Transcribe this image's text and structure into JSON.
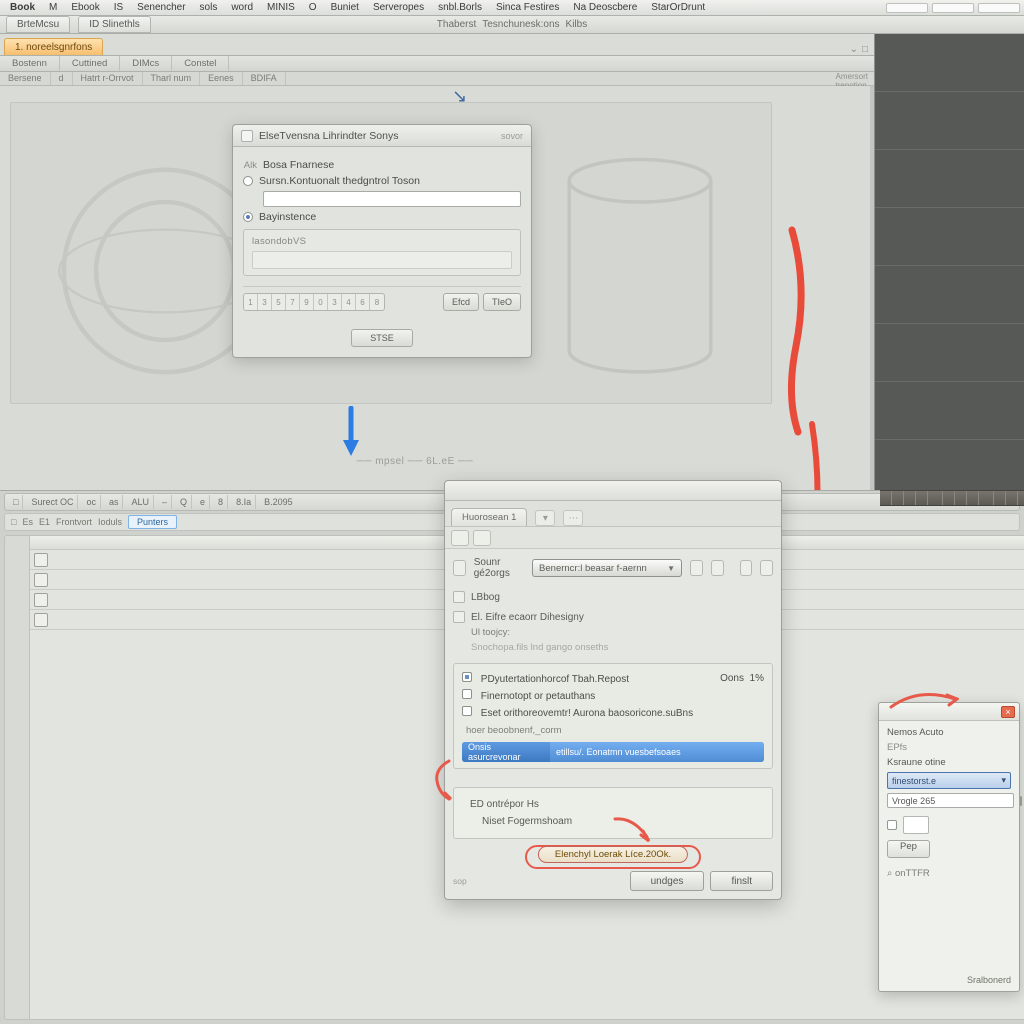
{
  "menubar": {
    "items": [
      "Book",
      "M",
      "Ebook",
      "IS",
      "Senencher",
      "sols",
      "word",
      "MINIS",
      "O",
      "Buniet",
      "Serveropes",
      "snbl.Borls",
      "Sinca Festires",
      "Na Deoscbere",
      "StarOrDrunt"
    ],
    "right_boxes": 3
  },
  "header2": {
    "left_tab_a": "BrteMcsu",
    "left_tab_b": "ID Slinethls",
    "center_a": "Thaberst",
    "center_b": "Tesnchunesk:ons",
    "center_c": "Kilbs"
  },
  "tabs": {
    "active": "1. noreelsgnrfons",
    "trailing": [
      "⌄",
      "□"
    ]
  },
  "colhdrs": [
    "Bostenn",
    "Cuttined",
    "DIMcs",
    "Constel"
  ],
  "subhdr": {
    "items": [
      "Bersene",
      "d",
      "Hatrt r-Orrvot",
      "Tharl num",
      "Eenes",
      "BDIFA"
    ],
    "stub_a": "Amersort",
    "stub_b": "trenotion"
  },
  "canvas": {
    "underline": "── mpsel ── 6L.eE ──"
  },
  "dialog1": {
    "title": "ElseTvensna Lihrindter Sonys",
    "right_header": "sovor",
    "row_a_prefix": "Alk",
    "row_a_label": "Bosa Fnarnese",
    "row_b_label": "Sursn.Kontuonalt thedgntrol Toson",
    "row_b_value": "",
    "row_c_label": "Bayinstence",
    "frame_label": "lasondobVS",
    "segment": [
      "1",
      "3",
      "5",
      "7",
      "9",
      "0",
      "3",
      "4",
      "6",
      "8"
    ],
    "btn_a": "Efcd",
    "btn_b": "TIeO",
    "footer_btn": "STSE"
  },
  "lower_tb": {
    "items": [
      "□",
      "Surect OC",
      "oc",
      "as",
      "ALU",
      "–",
      "Q",
      "e",
      "8",
      "8.Ia",
      "B.2095"
    ]
  },
  "lower_tb2": {
    "items": [
      "□",
      "Es",
      "E1",
      "Frontvort",
      "Ioduls"
    ],
    "picked": "Punters"
  },
  "dialog2": {
    "tab": "Huorosean 1",
    "pick_label": "Sounr gé2orgs",
    "combo_value": "Benerncr:l beasar f-aernn",
    "sec1_title": "LBbog",
    "sec2_title": "El. Eifre ecaorr Dihesigny",
    "sec2_sub": "Ul toojcy:",
    "sec2_hint": "Snochopa.fils lnd gango onseths",
    "run_title": "PDyutertationhorcof Tbah.Repost",
    "run_right": "Oons",
    "run_pct": "1%",
    "run_opt1": "Finernotopt or petauthans",
    "run_opt2": "Eset orithoreovemtr! Aurona baosoricone.suBns",
    "run_small": "hoer beoobnenf,_corm",
    "sel_left": "Onsis asurcrevonar",
    "sel_right": "etillsu/. Eonatmn vuesbefsoaes",
    "panel_a": "ED ontrépor Hs",
    "panel_b": "Niset Fogermshoam",
    "hist_btn": "Elenchyl Loerak Líce.20Ok.",
    "btn_a": "undges",
    "btn_b": "finslt",
    "foot_left": "sop"
  },
  "dialog3": {
    "hdr_a": "Nemos Acuto",
    "hdr_b": "EPfs",
    "field1_label": "Ksraune otine",
    "combo_value": "finestorst.e",
    "field2_value": "Vrogle 265",
    "check_label": "",
    "btn": "Pep",
    "note": "⌕ onTTFR",
    "footer": "Sralbonerd"
  }
}
